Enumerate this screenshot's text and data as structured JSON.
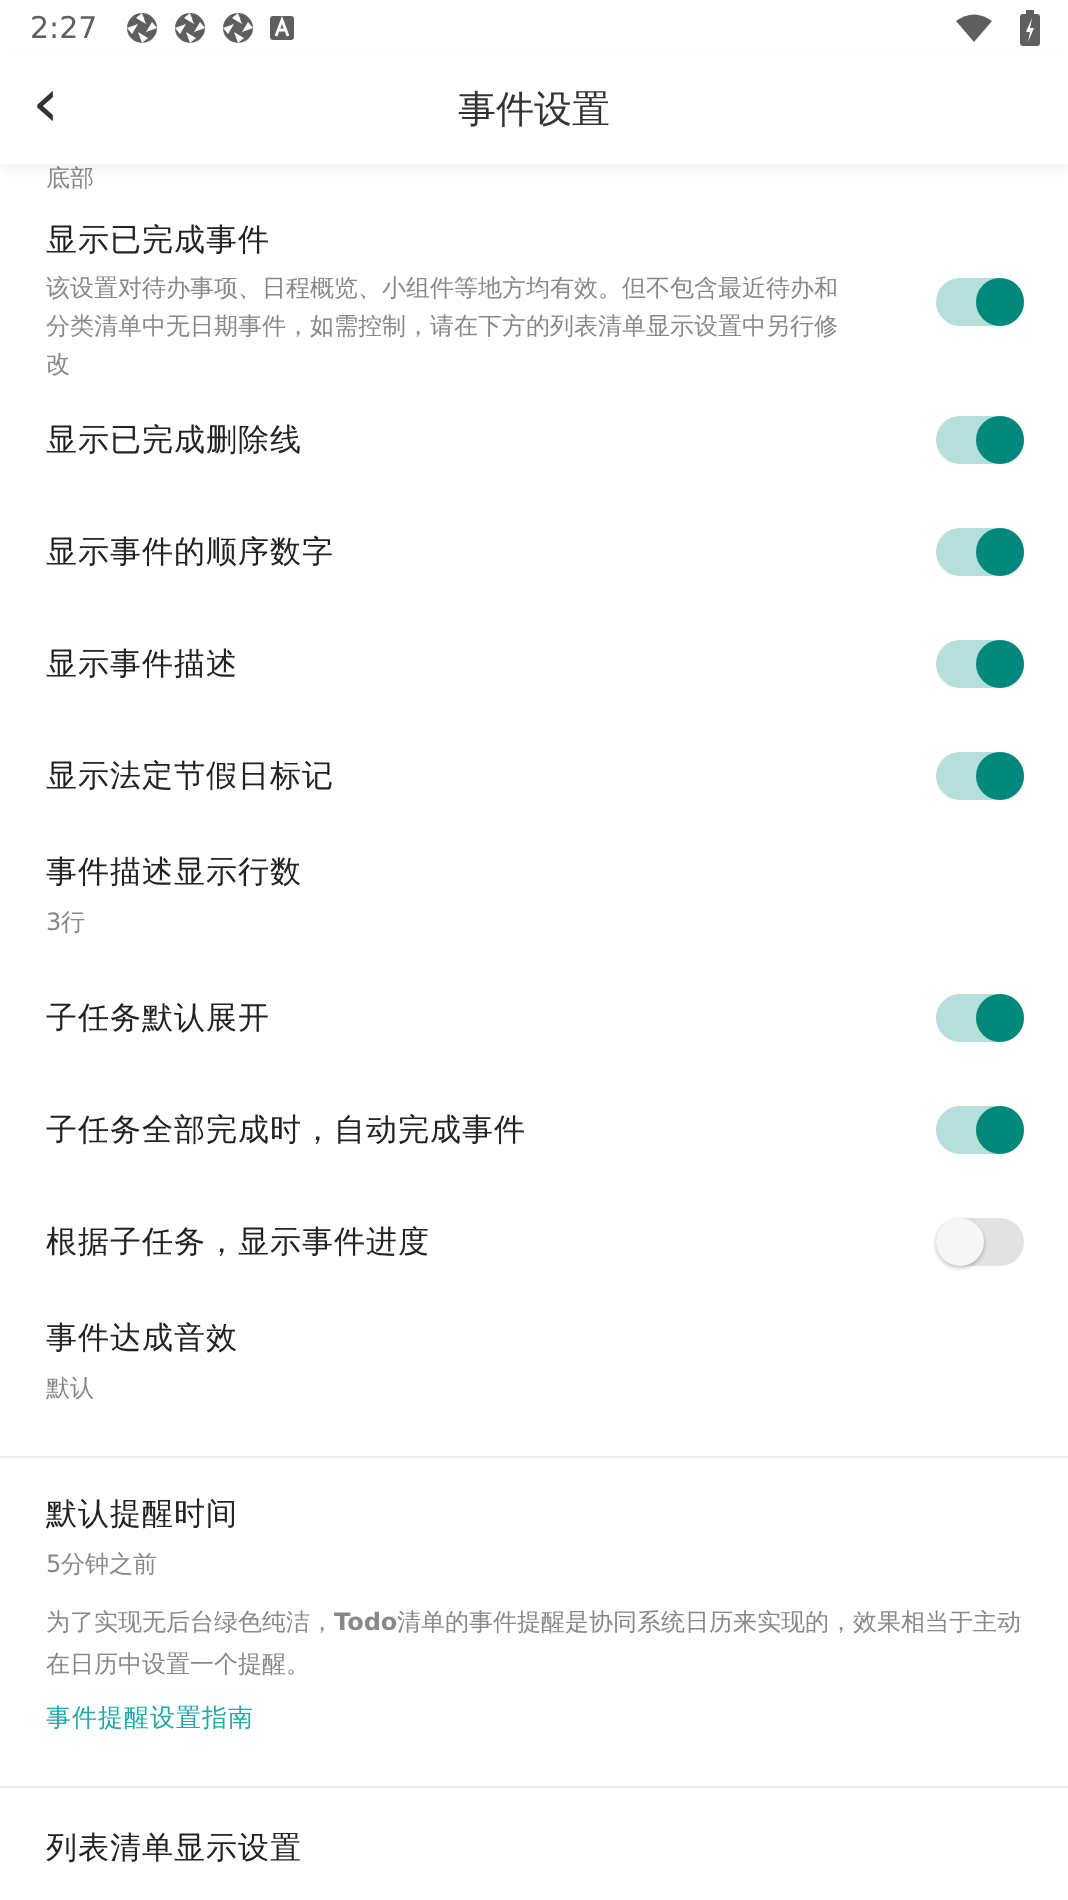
{
  "status_bar": {
    "time": "2:27"
  },
  "header": {
    "back": "‹",
    "title": "事件设置"
  },
  "partial_value": "底部",
  "sections": [
    {
      "items": [
        {
          "kind": "toggle",
          "title": "显示已完成事件",
          "description": "该设置对待办事项、日程概览、小组件等地方均有效。但不包含最近待办和分类清单中无日期事件，如需控制，请在下方的列表清单显示设置中另行修改",
          "on": true
        },
        {
          "kind": "toggle",
          "title": "显示已完成删除线",
          "on": true
        },
        {
          "kind": "toggle",
          "title": "显示事件的顺序数字",
          "on": true
        },
        {
          "kind": "toggle",
          "title": "显示事件描述",
          "on": true
        },
        {
          "kind": "toggle",
          "title": "显示法定节假日标记",
          "on": true
        },
        {
          "kind": "value",
          "title": "事件描述显示行数",
          "value": "3行"
        },
        {
          "kind": "toggle",
          "title": "子任务默认展开",
          "on": true
        },
        {
          "kind": "toggle",
          "title": "子任务全部完成时，自动完成事件",
          "on": true
        },
        {
          "kind": "toggle",
          "title": "根据子任务，显示事件进度",
          "on": false
        },
        {
          "kind": "value",
          "title": "事件达成音效",
          "value": "默认"
        }
      ]
    },
    {
      "items": [
        {
          "kind": "value",
          "title": "默认提醒时间",
          "value": "5分钟之前",
          "note": "为了实现无后台绿色纯洁，**Todo**清单的事件提醒是协同系统日历来实现的，效果相当于主动在日历中设置一个提醒。",
          "link": "事件提醒设置指南"
        }
      ]
    },
    {
      "items": [
        {
          "kind": "heading",
          "title": "列表清单显示设置"
        }
      ]
    }
  ]
}
